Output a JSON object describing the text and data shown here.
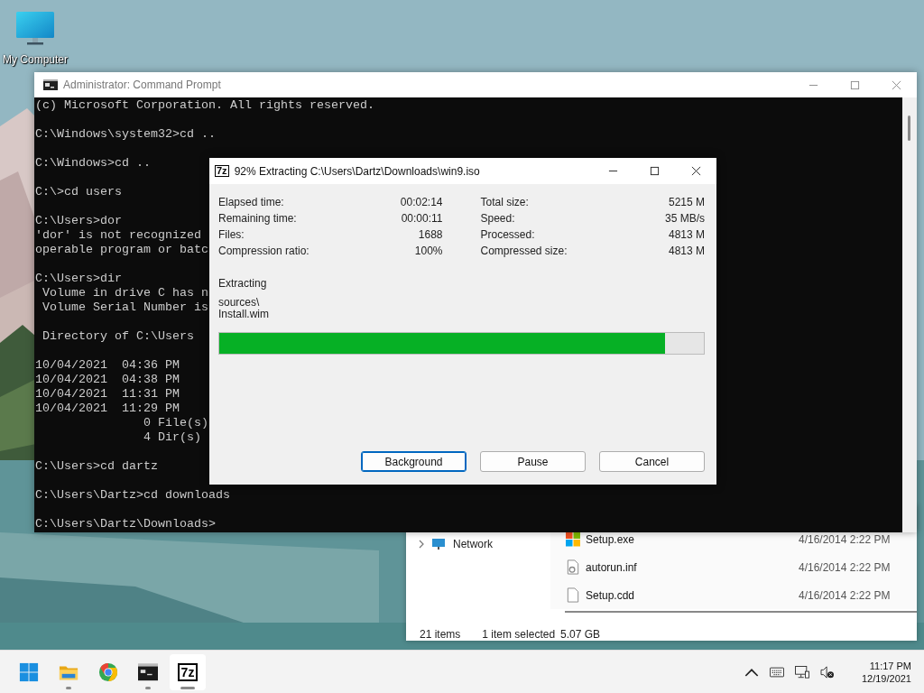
{
  "desktop": {
    "icons": [
      {
        "label": "My Computer"
      }
    ]
  },
  "console_window": {
    "title": "Administrator: Command Prompt",
    "active": false,
    "blocks": [
      [
        "(c) Microsoft Corporation. All rights reserved."
      ],
      [
        "C:\\Windows\\system32>cd .."
      ],
      [
        "C:\\Windows>cd .."
      ],
      [
        "C:\\>cd users"
      ],
      [
        "C:\\Users>dor",
        "'dor' is not recognized",
        "operable program or batc"
      ],
      [
        "C:\\Users>dir",
        " Volume in drive C has n",
        " Volume Serial Number is"
      ],
      [
        " Directory of C:\\Users"
      ],
      [
        "10/04/2021  04:36 PM",
        "10/04/2021  04:38 PM",
        "10/04/2021  11:31 PM",
        "10/04/2021  11:29 PM",
        "               0 File(s)",
        "               4 Dir(s)"
      ],
      [
        "C:\\Users>cd dartz"
      ],
      [
        "C:\\Users\\Dartz>cd downloads"
      ],
      [
        "C:\\Users\\Dartz\\Downloads>"
      ]
    ]
  },
  "dialog": {
    "logo": "7z",
    "title": "92% Extracting C:\\Users\\Dartz\\Downloads\\win9.iso",
    "stats_left": [
      {
        "label": "Elapsed time:",
        "value": "00:02:14"
      },
      {
        "label": "Remaining time:",
        "value": "00:00:11"
      },
      {
        "label": "Files:",
        "value": "1688"
      },
      {
        "label": "Compression ratio:",
        "value": "100%"
      }
    ],
    "stats_right": [
      {
        "label": "Total size:",
        "value": "5215 M"
      },
      {
        "label": "Speed:",
        "value": "35 MB/s"
      },
      {
        "label": "Processed:",
        "value": "4813 M"
      },
      {
        "label": "Compressed size:",
        "value": "4813 M"
      }
    ],
    "status": "Extracting",
    "current_file": [
      "sources\\",
      "Install.wim"
    ],
    "progress": {
      "level": 0.92
    },
    "buttons": [
      {
        "label": "Background",
        "focused": true
      },
      {
        "label": "Pause",
        "focused": false
      },
      {
        "label": "Cancel",
        "focused": false
      }
    ]
  },
  "explorer": {
    "nav_items": [
      {
        "label": "Network"
      }
    ],
    "files": [
      {
        "kind": "exe",
        "name": "Setup.exe",
        "date": "4/16/2014 2:22 PM"
      },
      {
        "kind": "inf",
        "name": "autorun.inf",
        "date": "4/16/2014 2:22 PM"
      },
      {
        "kind": "file",
        "name": "Setup.cdd",
        "date": "4/16/2014 2:22 PM"
      }
    ],
    "status_bar": {
      "count": "21 items",
      "selection": "1 item selected",
      "size": "5.07 GB"
    }
  },
  "taskbar": {
    "apps": [
      {
        "kind": "folder",
        "running": true,
        "selected": false
      },
      {
        "kind": "chrome",
        "running": false,
        "selected": false
      },
      {
        "kind": "console",
        "running": true,
        "selected": false
      },
      {
        "kind": "archiver",
        "logo": "7z",
        "running": true,
        "selected": true
      }
    ],
    "time": "11:17 PM",
    "date": "12/19/2021"
  }
}
